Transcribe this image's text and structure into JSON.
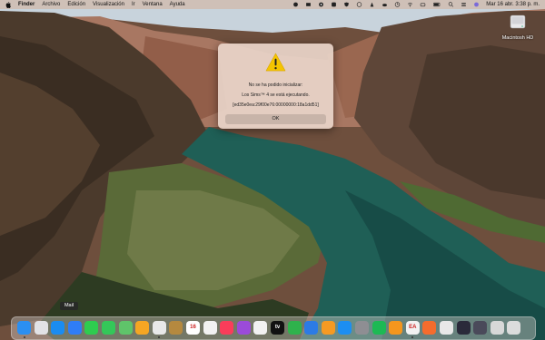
{
  "menubar": {
    "app_name": "Finder",
    "items": [
      "Archivo",
      "Edición",
      "Visualización",
      "Ir",
      "Ventana",
      "Ayuda"
    ],
    "clock": "Mar 16 abr.  3:38 p. m.",
    "status_icons": [
      "record-icon",
      "media-icon",
      "play-icon",
      "app-icon",
      "shield-icon",
      "antivirus-icon",
      "adobe-icon",
      "cloud-icon",
      "timemachine-icon",
      "wifi-icon",
      "keyboard-icon",
      "battery-icon",
      "search-icon",
      "control-center-icon",
      "siri-icon"
    ]
  },
  "desktop": {
    "drive_label": "Macintosh HD"
  },
  "alert": {
    "title": "No se ha podido inicializar:",
    "message": "Los Sims™ 4 se está ejecutando.",
    "code": "[ed35e0ea:29f00e76:00000000:18a1dd51]",
    "ok_label": "OK"
  },
  "tooltip": {
    "label": "Mail"
  },
  "dock": {
    "apps": [
      {
        "name": "Finder",
        "color": "#2b8ff2"
      },
      {
        "name": "Launchpad",
        "color": "#e2e2e6"
      },
      {
        "name": "Safari",
        "color": "#1a8cf0"
      },
      {
        "name": "Mail",
        "color": "#2f7df6"
      },
      {
        "name": "FaceTime",
        "color": "#2ecc4f"
      },
      {
        "name": "Messages",
        "color": "#34c759"
      },
      {
        "name": "Maps",
        "color": "#5fc46a"
      },
      {
        "name": "Photos",
        "color": "#f5a623"
      },
      {
        "name": "Chrome",
        "color": "#e8e8e8"
      },
      {
        "name": "Contacts",
        "color": "#b5893f"
      },
      {
        "name": "Calendar",
        "color": "#ffffff",
        "text": "16"
      },
      {
        "name": "Reminders",
        "color": "#f2f2f2"
      },
      {
        "name": "Music",
        "color": "#fa3d5a"
      },
      {
        "name": "Podcasts",
        "color": "#9b4bd9"
      },
      {
        "name": "Notes",
        "color": "#f2f2f2"
      },
      {
        "name": "TV",
        "color": "#111111",
        "text": "tv"
      },
      {
        "name": "Numbers",
        "color": "#2fb24c"
      },
      {
        "name": "Keynote",
        "color": "#2c7be5"
      },
      {
        "name": "Pages",
        "color": "#f59a23"
      },
      {
        "name": "App Store",
        "color": "#1c8ef2"
      },
      {
        "name": "System Preferences",
        "color": "#8e8e93"
      },
      {
        "name": "Spotify",
        "color": "#1db954"
      },
      {
        "name": "Books",
        "color": "#f5961d"
      },
      {
        "name": "EA",
        "color": "#f2f2f2",
        "text": "EA"
      },
      {
        "name": "Origin",
        "color": "#f56c2d"
      },
      {
        "name": "Vectorworks",
        "color": "#e8e8e8"
      },
      {
        "name": "Screen",
        "color": "#2a2a3a"
      },
      {
        "name": "Folder",
        "color": "#4a4a5a"
      },
      {
        "name": "Folder2",
        "color": "#d8d8d8"
      },
      {
        "name": "Trash",
        "color": "#dcdcdc"
      }
    ]
  }
}
